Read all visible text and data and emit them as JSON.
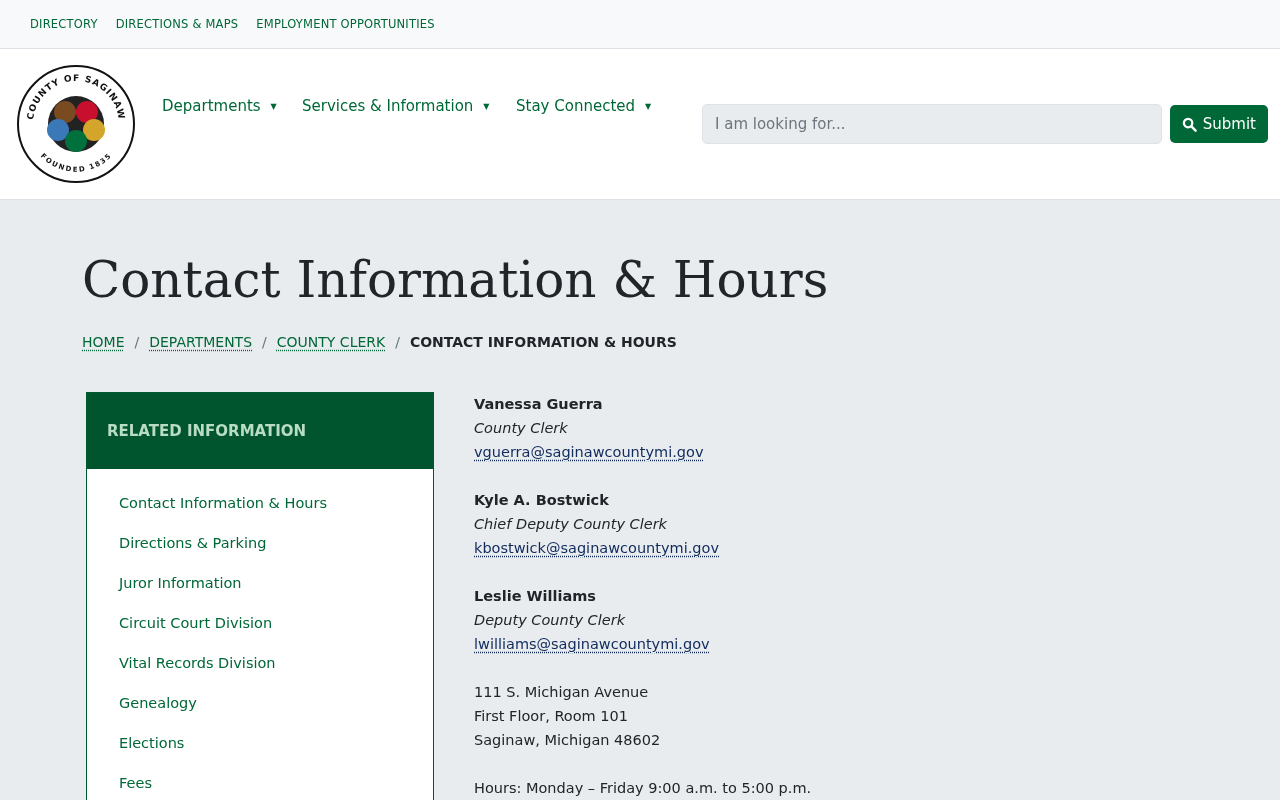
{
  "utility_nav": [
    "DIRECTORY",
    "DIRECTIONS & MAPS",
    "EMPLOYMENT OPPORTUNITIES"
  ],
  "logo": {
    "top_text": "COUNTY OF SAGINAW",
    "bottom_text": "FOUNDED 1835"
  },
  "main_nav": [
    {
      "label": "Departments",
      "caret": "▼"
    },
    {
      "label": "Services & Information",
      "caret": "▼"
    },
    {
      "label": "Stay Connected",
      "caret": "▼"
    }
  ],
  "search": {
    "placeholder": "I am looking for...",
    "button": "Submit"
  },
  "page_title": "Contact Information & Hours",
  "breadcrumb": [
    {
      "label": "HOME",
      "kind": "link"
    },
    {
      "label": "DEPARTMENTS",
      "kind": "link"
    },
    {
      "label": "COUNTY CLERK",
      "kind": "link"
    },
    {
      "label": "CONTACT INFORMATION & HOURS",
      "kind": "current"
    }
  ],
  "breadcrumb_separator": "/",
  "sidebar": {
    "title": "RELATED INFORMATION",
    "items": [
      "Contact Information & Hours",
      "Directions & Parking",
      "Juror Information",
      "Circuit Court Division",
      "Vital Records Division",
      "Genealogy",
      "Elections",
      "Fees"
    ]
  },
  "contacts": [
    {
      "name": "Vanessa Guerra",
      "role": "County Clerk",
      "email": "vguerra@saginawcountymi.gov"
    },
    {
      "name": "Kyle A. Bostwick",
      "role": "Chief Deputy County Clerk",
      "email": "kbostwick@saginawcountymi.gov"
    },
    {
      "name": "Leslie Williams",
      "role": "Deputy County Clerk",
      "email": "lwilliams@saginawcountymi.gov"
    }
  ],
  "address": [
    "111 S. Michigan Avenue",
    "First Floor, Room 101",
    "Saginaw, Michigan 48602"
  ],
  "hours": "Hours: Monday – Friday 9:00 a.m. to 5:00 p.m."
}
